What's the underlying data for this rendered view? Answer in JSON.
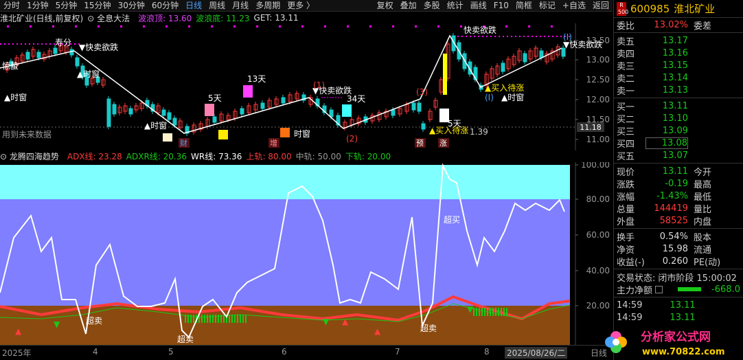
{
  "toolbar": {
    "periods": [
      "分时",
      "1分钟",
      "5分钟",
      "15分钟",
      "30分钟",
      "60分钟",
      "日线",
      "周线",
      "月线",
      "多周期",
      "更多 〉"
    ],
    "active": "日线",
    "right": [
      "复权",
      "叠加",
      "多股",
      "统计",
      "画线",
      "F10",
      "简框",
      "标记",
      "+自选",
      "返回"
    ]
  },
  "title": {
    "name": "淮北矿业(日线,前复权)",
    "indicator": "全息大法",
    "wave_top": "波浪顶: 13.60",
    "wave_bottom": "波浪底: 11.23",
    "get": "GET: 13.11"
  },
  "main_axis": [
    "13.50",
    "13.00",
    "12.50",
    "12.00",
    "11.50",
    "11.00"
  ],
  "price_marker": "11.18",
  "main_labels": {
    "future": "用到未来数据",
    "kuaimai1": "▼快卖欲跌",
    "kuaimai2": "▼快卖欲跌",
    "kuaimai3": "▼快卖欲跌",
    "kuaimai4": "快卖欲跌",
    "shichuang1": "▲时窗",
    "shichuang2": "▲时窗",
    "shichuang3": "▲时窗",
    "shichuang4": "▲时窗",
    "shichuang5": "时窗",
    "shichuang6": "▲时窗",
    "shouzhang": "寿分",
    "jingzhe": "惊蛰",
    "d5": "5天",
    "d13": "13天",
    "d34": "34天",
    "d5b": "5天",
    "mairu1": "▲买入待涨",
    "mairu2": "▲买入待涨",
    "wave1": "(I)",
    "wave2": "(I)",
    "num3": "(3)",
    "num1": "(1)",
    "num2": "(2)",
    "v139": "1.39",
    "cai": "财",
    "zeng": "增",
    "yu": "预",
    "zhang": "涨"
  },
  "ind": {
    "name": "龙腾四海趋势",
    "adx": "ADX线: 23.28",
    "adxr": "ADXR线: 20.36",
    "wr": "WR线: 73.36",
    "upper": "上轨: 80.00",
    "mid": "中轨: 50.00",
    "lower": "下轨: 20.00",
    "axis": [
      "100.00",
      "80.00",
      "60.00",
      "40.00",
      "20.00"
    ],
    "chaomai": "超买",
    "chaomai2": "超卖",
    "chaomai3": "超卖",
    "chaomai4": "超卖"
  },
  "dates": [
    "2025年",
    "4",
    "5",
    "6",
    "7",
    "8",
    "2025/08/26/二",
    "日线"
  ],
  "quote": {
    "code": "600985",
    "name": "淮北矿业",
    "ratio_label": "委比",
    "ratio": "13.02%",
    "diff_label": "委差",
    "sell": [
      {
        "l": "卖五",
        "v": "13.17"
      },
      {
        "l": "卖四",
        "v": "13.16"
      },
      {
        "l": "卖三",
        "v": "13.15"
      },
      {
        "l": "卖二",
        "v": "13.14"
      },
      {
        "l": "卖一",
        "v": "13.13"
      }
    ],
    "buy": [
      {
        "l": "买一",
        "v": "13.11"
      },
      {
        "l": "买二",
        "v": "13.10"
      },
      {
        "l": "买三",
        "v": "13.09"
      },
      {
        "l": "买四",
        "v": "13.08"
      },
      {
        "l": "买五",
        "v": "13.07"
      }
    ],
    "stats": [
      {
        "l": "现价",
        "v": "13.11",
        "x": "今开",
        "c": "green"
      },
      {
        "l": "涨跌",
        "v": "-0.19",
        "x": "最高",
        "c": "green"
      },
      {
        "l": "涨幅",
        "v": "-1.43%",
        "x": "最低",
        "c": "green"
      },
      {
        "l": "总量",
        "v": "144419",
        "x": "量比",
        "c": "red"
      },
      {
        "l": "外盘",
        "v": "58525",
        "x": "内盘",
        "c": "red"
      }
    ],
    "stats2": [
      {
        "l": "换手",
        "v": "0.54%",
        "x": "股本",
        "c": "white"
      },
      {
        "l": "净资",
        "v": "15.98",
        "x": "流通",
        "c": "white"
      },
      {
        "l": "收益(-)",
        "v": "0.260",
        "x": "PE(动)",
        "c": "white"
      }
    ],
    "status_label": "交易状态:",
    "status": "闭市阶段 15:00:02",
    "net_label": "主力净额",
    "net": "-668.0",
    "ticks": [
      {
        "t": "14:59",
        "v": "13.11"
      },
      {
        "t": "14:59",
        "v": "13.11"
      }
    ],
    "r500": "R 500"
  },
  "watermark": {
    "text": "分析家公式网",
    "url": "www.70822.com"
  }
}
